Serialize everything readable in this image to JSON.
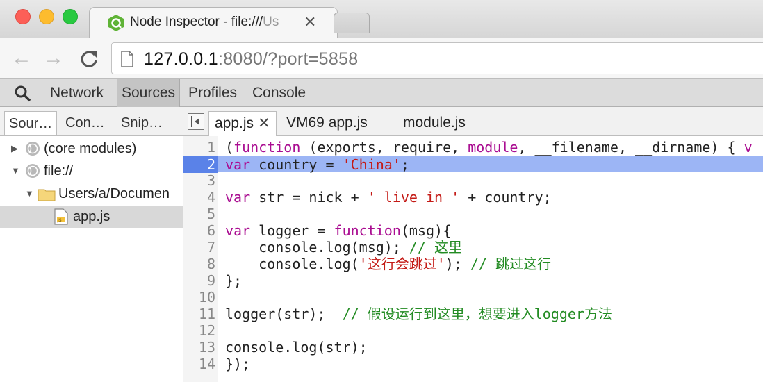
{
  "browser": {
    "tab_title_visible": "Node Inspector - file:///",
    "tab_title_faded": "Us",
    "tab_close": "✕",
    "url_host": "127.0.0.1",
    "url_rest": ":8080/?port=5858"
  },
  "devtools": {
    "panels": [
      "Network",
      "Sources",
      "Profiles",
      "Console"
    ],
    "active_panel": "Sources"
  },
  "navigator": {
    "tabs": [
      "Sour…",
      "Con…",
      "Snip…"
    ],
    "tree": [
      {
        "label": "(core modules)",
        "expanded": false,
        "icon": "globe-icon"
      },
      {
        "label": "file://",
        "expanded": true,
        "icon": "globe-icon"
      },
      {
        "label": "Users/a/Documen",
        "expanded": true,
        "icon": "folder-icon"
      },
      {
        "label": "app.js",
        "selected": true,
        "icon": "js-file-icon"
      }
    ]
  },
  "editor": {
    "tabs": [
      {
        "label": "app.js",
        "close": "✕"
      },
      {
        "label": "VM69 app.js"
      },
      {
        "label": "module.js"
      }
    ],
    "current_line": 2,
    "lines": [
      {
        "n": "1",
        "tokens": [
          [
            "p",
            "("
          ],
          [
            "kw",
            "function"
          ],
          [
            "p",
            " (exports, require, "
          ],
          [
            "kw",
            "module"
          ],
          [
            "p",
            ", __filename, __dirname) { "
          ],
          [
            "kw",
            "v"
          ]
        ]
      },
      {
        "n": "2",
        "tokens": [
          [
            "kw",
            "var"
          ],
          [
            "p",
            " country = "
          ],
          [
            "str",
            "'China'"
          ],
          [
            "p",
            ";"
          ]
        ]
      },
      {
        "n": "3",
        "tokens": []
      },
      {
        "n": "4",
        "tokens": [
          [
            "kw",
            "var"
          ],
          [
            "p",
            " str = nick + "
          ],
          [
            "str",
            "' live in '"
          ],
          [
            "p",
            " + country;"
          ]
        ]
      },
      {
        "n": "5",
        "tokens": []
      },
      {
        "n": "6",
        "tokens": [
          [
            "kw",
            "var"
          ],
          [
            "p",
            " logger = "
          ],
          [
            "kw",
            "function"
          ],
          [
            "p",
            "(msg){"
          ]
        ]
      },
      {
        "n": "7",
        "tokens": [
          [
            "p",
            "    console.log(msg); "
          ],
          [
            "cm",
            "// 这里"
          ]
        ]
      },
      {
        "n": "8",
        "tokens": [
          [
            "p",
            "    console.log("
          ],
          [
            "str",
            "'这行会跳过'"
          ],
          [
            "p",
            "); "
          ],
          [
            "cm",
            "// 跳过这行"
          ]
        ]
      },
      {
        "n": "9",
        "tokens": [
          [
            "p",
            "};"
          ]
        ]
      },
      {
        "n": "10",
        "tokens": []
      },
      {
        "n": "11",
        "tokens": [
          [
            "p",
            "logger(str);  "
          ],
          [
            "cm",
            "// 假设运行到这里，想要进入logger方法"
          ]
        ]
      },
      {
        "n": "12",
        "tokens": []
      },
      {
        "n": "13",
        "tokens": [
          [
            "p",
            "console.log(str);"
          ]
        ]
      },
      {
        "n": "14",
        "tokens": [
          [
            "p",
            "});"
          ]
        ]
      }
    ]
  }
}
